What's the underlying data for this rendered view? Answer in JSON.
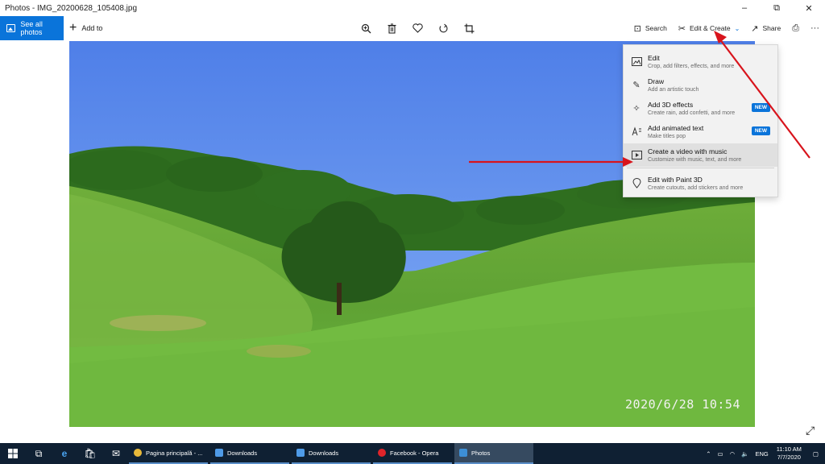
{
  "window": {
    "title": "Photos - IMG_20200628_105408.jpg",
    "minimize": "–",
    "maximize": "⧉",
    "close": "✕"
  },
  "toolbar": {
    "see_all_label": "See all photos",
    "add_to_label": "Add to",
    "search_label": "Search",
    "edit_create_label": "Edit & Create",
    "share_label": "Share",
    "more": "···"
  },
  "photo": {
    "timestamp": "2020/6/28  10:54"
  },
  "menu": {
    "items": [
      {
        "title": "Edit",
        "subtitle": "Crop, add filters, effects, and more",
        "icon": "edit-image-icon",
        "badge": ""
      },
      {
        "title": "Draw",
        "subtitle": "Add an artistic touch",
        "icon": "pen-icon",
        "badge": ""
      },
      {
        "title": "Add 3D effects",
        "subtitle": "Create rain, add confetti, and more",
        "icon": "3d-effects-icon",
        "badge": "NEW"
      },
      {
        "title": "Add animated text",
        "subtitle": "Make titles pop",
        "icon": "animated-text-icon",
        "badge": "NEW"
      },
      {
        "title": "Create a video with music",
        "subtitle": "Customize with music, text, and more",
        "icon": "video-icon",
        "badge": ""
      },
      {
        "title": "Edit with Paint 3D",
        "subtitle": "Create cutouts, add stickers and more",
        "icon": "paint3d-icon",
        "badge": ""
      }
    ]
  },
  "taskbar": {
    "apps": [
      {
        "label": "Pagina principală - ...",
        "icon": "chrome-icon",
        "color": "#e8b93a"
      },
      {
        "label": "Downloads",
        "icon": "downloads-icon",
        "color": "#4f9be8"
      },
      {
        "label": "Downloads",
        "icon": "downloads-icon",
        "color": "#4f9be8"
      },
      {
        "label": "Facebook - Opera",
        "icon": "opera-icon",
        "color": "#e0242a"
      },
      {
        "label": "Photos",
        "icon": "photos-icon",
        "color": "#3d8fd6"
      }
    ],
    "language": "ENG",
    "time": "11:10 AM",
    "date": "7/7/2020"
  },
  "colors": {
    "accent": "#0a74da",
    "annotation_red": "#d8141c",
    "taskbar": "#0f2033"
  }
}
